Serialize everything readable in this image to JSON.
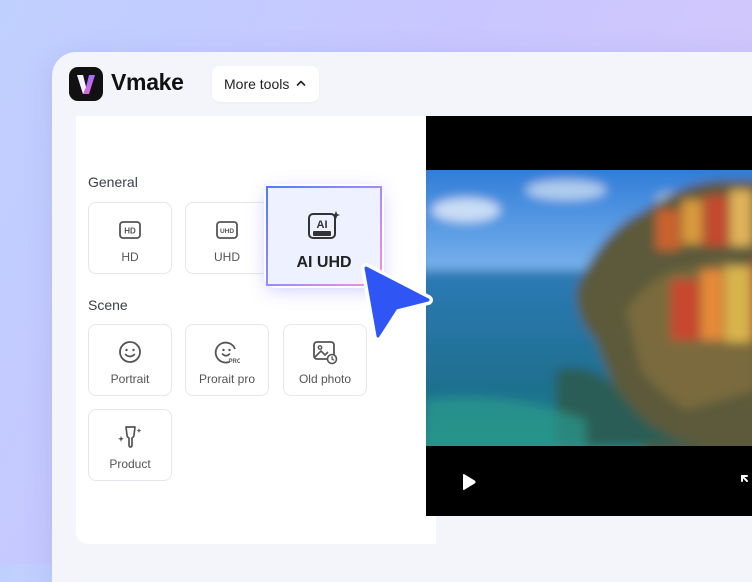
{
  "app": {
    "name": "Vmake"
  },
  "toolbar": {
    "more_tools_label": "More tools"
  },
  "sidebar": {
    "general_label": "General",
    "scene_label": "Scene",
    "general_items": [
      {
        "label": "HD",
        "icon": "hd-icon"
      },
      {
        "label": "UHD",
        "icon": "uhd-icon"
      },
      {
        "label": "AI UHD",
        "icon": "ai-ultra-icon",
        "selected": true
      }
    ],
    "scene_items": [
      {
        "label": "Portrait",
        "icon": "smile-icon"
      },
      {
        "label": "Prorait pro",
        "icon": "smile-pro-icon"
      },
      {
        "label": "Old photo",
        "icon": "old-photo-icon"
      },
      {
        "label": "Product",
        "icon": "product-icon"
      }
    ]
  },
  "colors": {
    "accent": "#2f56f5",
    "brand_gradient_start": "#4f7cff",
    "brand_gradient_end": "#ff5fa8"
  }
}
